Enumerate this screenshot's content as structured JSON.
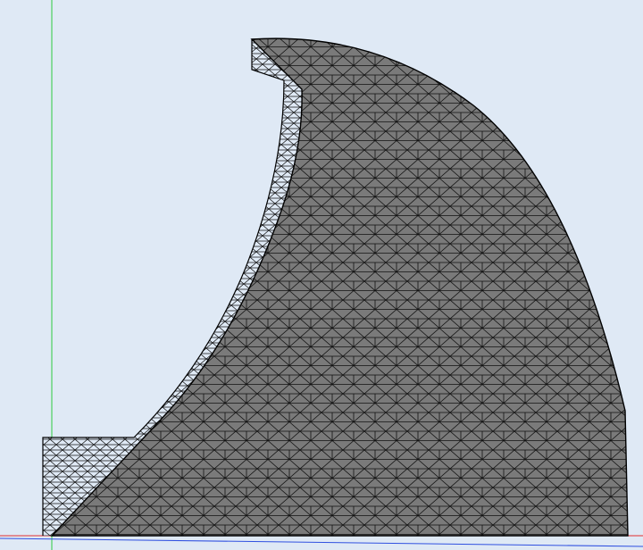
{
  "viewport": {
    "background": "#dfe9f5"
  },
  "axes": {
    "x_axis_color": "#e03030",
    "y_axis_color": "#2ecc40",
    "z_axis_color": "#3050e0"
  },
  "mesh": {
    "shaded_fill": "#7a7a7a",
    "wire_color": "#111111",
    "outline_color": "#000000",
    "display_mode": "shaded-with-edges"
  }
}
